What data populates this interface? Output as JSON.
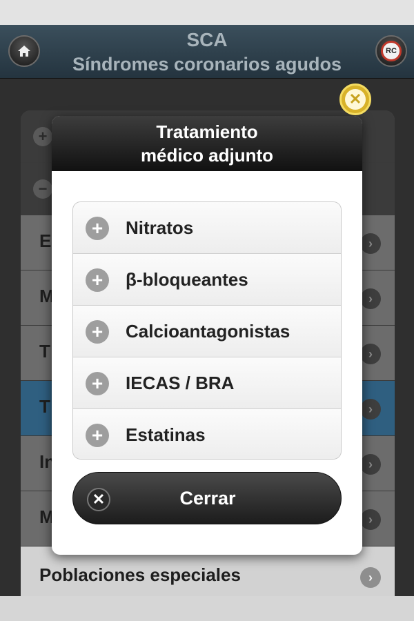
{
  "header": {
    "title": "SCA",
    "subtitle": "Síndromes coronarios agudos",
    "home_icon": "home-icon",
    "logo_text": "RC"
  },
  "background_list": {
    "items": [
      {
        "label": "",
        "type": "expand"
      },
      {
        "label": "",
        "type": "collapse"
      },
      {
        "label": "E",
        "type": "link"
      },
      {
        "label": "M",
        "type": "link"
      },
      {
        "label": "T",
        "type": "link"
      },
      {
        "label": "T",
        "type": "link",
        "active": true
      },
      {
        "label": "In",
        "type": "link"
      },
      {
        "label": "M",
        "type": "link"
      },
      {
        "label": "Poblaciones especiales",
        "type": "link"
      }
    ]
  },
  "dialog": {
    "title_line1": "Tratamiento",
    "title_line2": "médico adjunto",
    "items": [
      {
        "label": "Nitratos"
      },
      {
        "label": "β-bloqueantes"
      },
      {
        "label": "Calcioantagonistas"
      },
      {
        "label": "IECAS / BRA"
      },
      {
        "label": "Estatinas"
      }
    ],
    "close_button_label": "Cerrar"
  },
  "colors": {
    "header_bg": "#2d3f4a",
    "active_row": "#2f5f80",
    "close_badge": "#d8b229"
  }
}
